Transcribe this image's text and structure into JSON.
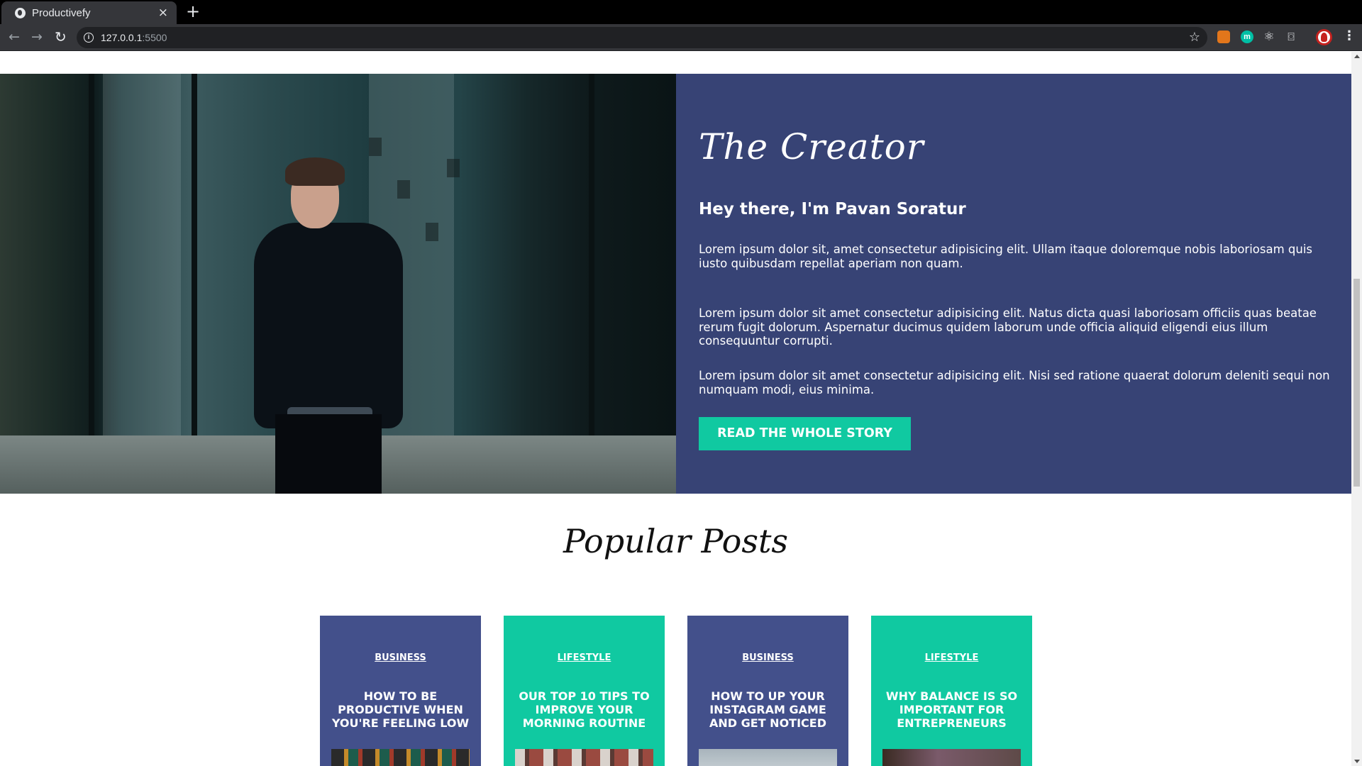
{
  "browser": {
    "tab_title": "Productivefy",
    "tab_close": "×",
    "new_tab": "+",
    "url_host": "127.0.0.1",
    "url_port": ":5500",
    "back": "←",
    "forward": "→",
    "reload": "↻",
    "bookmark": "☆",
    "menu": "⋮",
    "ext_m": "m",
    "ext_react": "⚛",
    "ext_camera": "⌼"
  },
  "creator": {
    "heading": "The Creator",
    "subheading": "Hey there, I'm Pavan Soratur",
    "paragraphs": [
      "Lorem ipsum dolor sit, amet consectetur adipisicing elit. Ullam itaque doloremque nobis laboriosam quis iusto quibusdam repellat aperiam non quam.",
      "Lorem ipsum dolor sit amet consectetur adipisicing elit. Natus dicta quasi laboriosam officiis quas beatae rerum fugit dolorum. Aspernatur ducimus quidem laborum unde officia aliquid eligendi eius illum consequuntur corrupti.",
      "Lorem ipsum dolor sit amet consectetur adipisicing elit. Nisi sed ratione quaerat dolorum deleniti sequi non numquam modi, eius minima."
    ],
    "cta_label": "READ THE WHOLE STORY"
  },
  "popular": {
    "heading": "Popular Posts",
    "posts": [
      {
        "category": "BUSINESS",
        "title": "HOW TO BE PRODUCTIVE WHEN YOU'RE FEELING LOW"
      },
      {
        "category": "LIFESTYLE",
        "title": "OUR TOP 10 TIPS TO IMPROVE YOUR MORNING ROUTINE"
      },
      {
        "category": "BUSINESS",
        "title": "HOW TO UP YOUR INSTAGRAM GAME AND GET NOTICED"
      },
      {
        "category": "LIFESTYLE",
        "title": "WHY BALANCE IS SO IMPORTANT FOR ENTREPRENEURS"
      }
    ]
  },
  "colors": {
    "panel_bg": "#374375",
    "card_blue": "#43508b",
    "accent_teal": "#10c9a1"
  }
}
